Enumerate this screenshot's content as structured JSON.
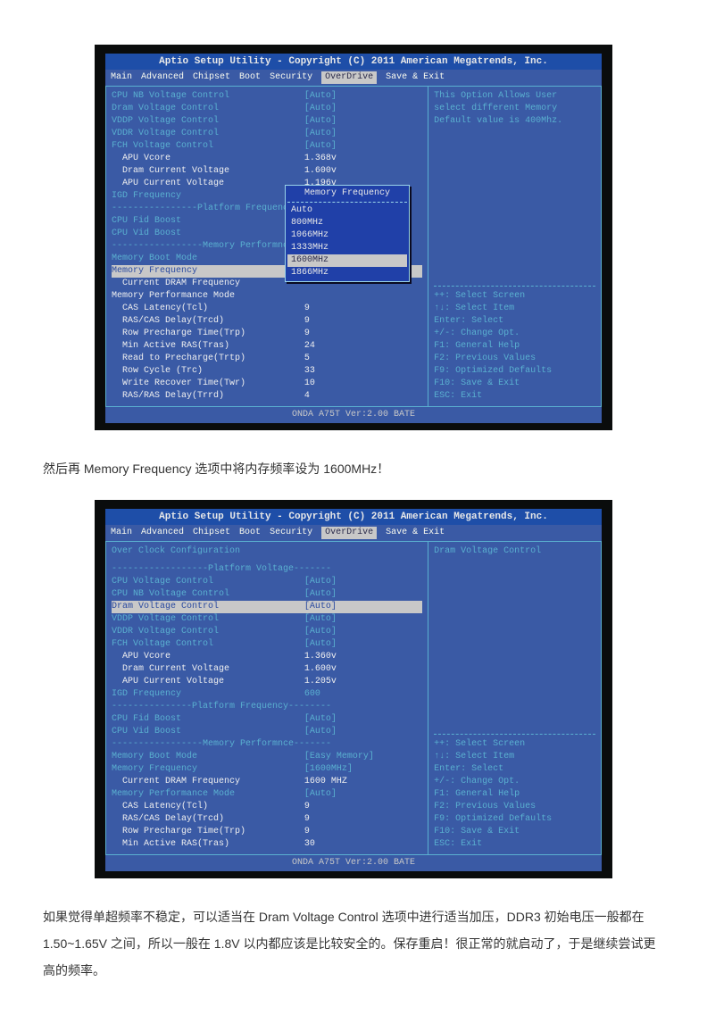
{
  "bios_header": {
    "title": "Aptio Setup Utility - Copyright (C) 2011 American Megatrends, Inc.",
    "menu": [
      "Main",
      "Advanced",
      "Chipset",
      "Boot",
      "Security",
      "OverDrive",
      "Save & Exit"
    ],
    "selected": "OverDrive",
    "footer": "ONDA A75T Ver:2.00 BATE"
  },
  "shot1": {
    "rows": [
      {
        "label": "CPU NB Voltage Control",
        "value": "[Auto]",
        "cls": ""
      },
      {
        "label": "Dram Voltage Control",
        "value": "[Auto]",
        "cls": ""
      },
      {
        "label": "VDDP Voltage Control",
        "value": "[Auto]",
        "cls": ""
      },
      {
        "label": "VDDR Voltage Control",
        "value": "[Auto]",
        "cls": ""
      },
      {
        "label": "FCH Voltage Control",
        "value": "[Auto]",
        "cls": ""
      },
      {
        "label": "  APU Vcore",
        "value": "1.368v",
        "cls": "white"
      },
      {
        "label": "  Dram Current Voltage",
        "value": "1.600v",
        "cls": "white"
      },
      {
        "label": "  APU Current Voltage",
        "value": "1.196v",
        "cls": "white"
      },
      {
        "label": "IGD Frequency",
        "value": "",
        "cls": ""
      },
      {
        "label": "----------------Platform Frequenc",
        "value": "",
        "cls": "section"
      },
      {
        "label": "CPU Fid Boost",
        "value": "",
        "cls": ""
      },
      {
        "label": "CPU Vid Boost",
        "value": "",
        "cls": ""
      },
      {
        "label": "-----------------Memory Performnc",
        "value": "",
        "cls": "section"
      },
      {
        "label": "Memory Boot Mode",
        "value": "",
        "cls": ""
      },
      {
        "label": "Memory Frequency",
        "value": "",
        "cls": "hl"
      },
      {
        "label": "  Current DRAM Frequency",
        "value": "",
        "cls": "white"
      },
      {
        "label": "Memory Performance Mode",
        "value": "",
        "cls": "white"
      },
      {
        "label": "  CAS Latency(Tcl)",
        "value": "9",
        "cls": "white"
      },
      {
        "label": "  RAS/CAS Delay(Trcd)",
        "value": "9",
        "cls": "white"
      },
      {
        "label": "  Row Precharge Time(Trp)",
        "value": "9",
        "cls": "white"
      },
      {
        "label": "  Min Active RAS(Tras)",
        "value": "24",
        "cls": "white"
      },
      {
        "label": "  Read to Precharge(Trtp)",
        "value": "5",
        "cls": "white"
      },
      {
        "label": "  Row Cycle (Trc)",
        "value": "33",
        "cls": "white"
      },
      {
        "label": "  Write Recover Time(Twr)",
        "value": "10",
        "cls": "white"
      },
      {
        "label": "  RAS/RAS Delay(Trrd)",
        "value": "4",
        "cls": "white"
      }
    ],
    "popup": {
      "title": "Memory Frequency",
      "options": [
        "Auto",
        "800MHz",
        "1066MHz",
        "1333MHz",
        "1600MHz",
        "1866MHz"
      ],
      "selected": "1600MHz"
    },
    "help": [
      "This Option Allows User",
      "select different Memory",
      "Default value is 400Mhz."
    ],
    "keys": [
      "++: Select Screen",
      "↑↓: Select Item",
      "Enter: Select",
      "+/-: Change Opt.",
      "F1: General Help",
      "F2: Previous Values",
      "F9: Optimized Defaults",
      "F10: Save & Exit",
      "ESC: Exit"
    ]
  },
  "text1": "然后再 Memory Frequency 选项中将内存频率设为 1600MHz！",
  "shot2": {
    "heading": "Over Clock Configuration",
    "rows": [
      {
        "label": "------------------Platform Voltage-------",
        "value": "",
        "cls": "section"
      },
      {
        "label": "CPU Voltage Control",
        "value": "[Auto]",
        "cls": ""
      },
      {
        "label": "CPU NB Voltage Control",
        "value": "[Auto]",
        "cls": ""
      },
      {
        "label": "Dram Voltage Control",
        "value": "[Auto]",
        "cls": "hl"
      },
      {
        "label": "VDDP Voltage Control",
        "value": "[Auto]",
        "cls": ""
      },
      {
        "label": "VDDR Voltage Control",
        "value": "[Auto]",
        "cls": ""
      },
      {
        "label": "FCH Voltage Control",
        "value": "[Auto]",
        "cls": ""
      },
      {
        "label": "  APU Vcore",
        "value": "1.360v",
        "cls": "white"
      },
      {
        "label": "  Dram Current Voltage",
        "value": "1.600v",
        "cls": "white"
      },
      {
        "label": "  APU Current Voltage",
        "value": "1.205v",
        "cls": "white"
      },
      {
        "label": "IGD Frequency",
        "value": "600",
        "cls": ""
      },
      {
        "label": "---------------Platform Frequency--------",
        "value": "",
        "cls": "section"
      },
      {
        "label": "CPU Fid Boost",
        "value": "[Auto]",
        "cls": ""
      },
      {
        "label": "CPU Vid Boost",
        "value": "[Auto]",
        "cls": ""
      },
      {
        "label": "-----------------Memory Performnce-------",
        "value": "",
        "cls": "section"
      },
      {
        "label": "Memory Boot Mode",
        "value": "[Easy Memory]",
        "cls": ""
      },
      {
        "label": "Memory Frequency",
        "value": "[1600MHz]",
        "cls": ""
      },
      {
        "label": "  Current DRAM Frequency",
        "value": "1600 MHZ",
        "cls": "white"
      },
      {
        "label": "Memory Performance Mode",
        "value": "[Auto]",
        "cls": ""
      },
      {
        "label": "  CAS Latency(Tcl)",
        "value": "9",
        "cls": "white"
      },
      {
        "label": "  RAS/CAS Delay(Trcd)",
        "value": "9",
        "cls": "white"
      },
      {
        "label": "  Row Precharge Time(Trp)",
        "value": "9",
        "cls": "white"
      },
      {
        "label": "  Min Active RAS(Tras)",
        "value": "30",
        "cls": "white"
      }
    ],
    "help": [
      "Dram Voltage Control"
    ],
    "keys": [
      "++: Select Screen",
      "↑↓: Select Item",
      "Enter: Select",
      "+/-: Change Opt.",
      "F1: General Help",
      "F2: Previous Values",
      "F9: Optimized Defaults",
      "F10: Save & Exit",
      "ESC: Exit"
    ]
  },
  "text2": "如果觉得单超频率不稳定，可以适当在 Dram Voltage Control 选项中进行适当加压，DDR3 初始电压一般都在 1.50~1.65V 之间，所以一般在 1.8V 以内都应该是比较安全的。保存重启！很正常的就启动了，于是继续尝试更高的频率。"
}
